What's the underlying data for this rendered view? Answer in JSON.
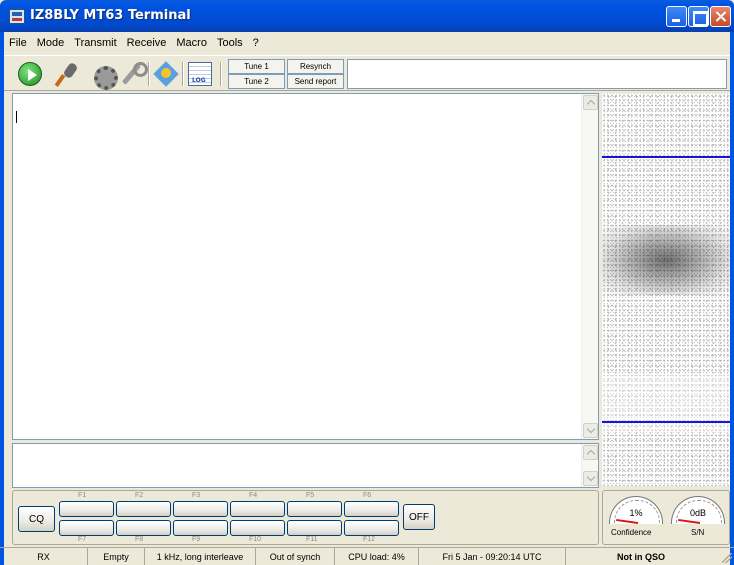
{
  "window": {
    "title": "IZ8BLY MT63 Terminal"
  },
  "menu": [
    "File",
    "Mode",
    "Transmit",
    "Receive",
    "Macro",
    "Tools",
    "?"
  ],
  "toolbar": {
    "tune1": "Tune 1",
    "tune2": "Tune 2",
    "resynch": "Resynch",
    "send_report": "Send report"
  },
  "macros": {
    "cq": "CQ",
    "off": "OFF",
    "top_labels": [
      "F1",
      "F2",
      "F3",
      "F4",
      "F5",
      "F6"
    ],
    "bottom_labels": [
      "F7",
      "F8",
      "F9",
      "F10",
      "F11",
      "F12"
    ]
  },
  "meters": {
    "confidence_value": "1%",
    "confidence_label": "Confidence",
    "sn_value": "0dB",
    "sn_label": "S/N"
  },
  "status": {
    "mode": "RX",
    "buffer": "Empty",
    "settings": "1 kHz, long interleave",
    "sync": "Out of synch",
    "cpu": "CPU load: 4%",
    "datetime": "Fri 5 Jan - 09:20:14 UTC",
    "qso": "Not in QSO"
  },
  "icons": [
    "play-icon",
    "microphone-icon",
    "gear-icon",
    "wrench-icon",
    "starburst-icon",
    "logbook-icon"
  ],
  "colors": {
    "title_bar": "#0054e3",
    "marker_lines": "#1616d8",
    "waterfall_bg": "#ffffff"
  }
}
